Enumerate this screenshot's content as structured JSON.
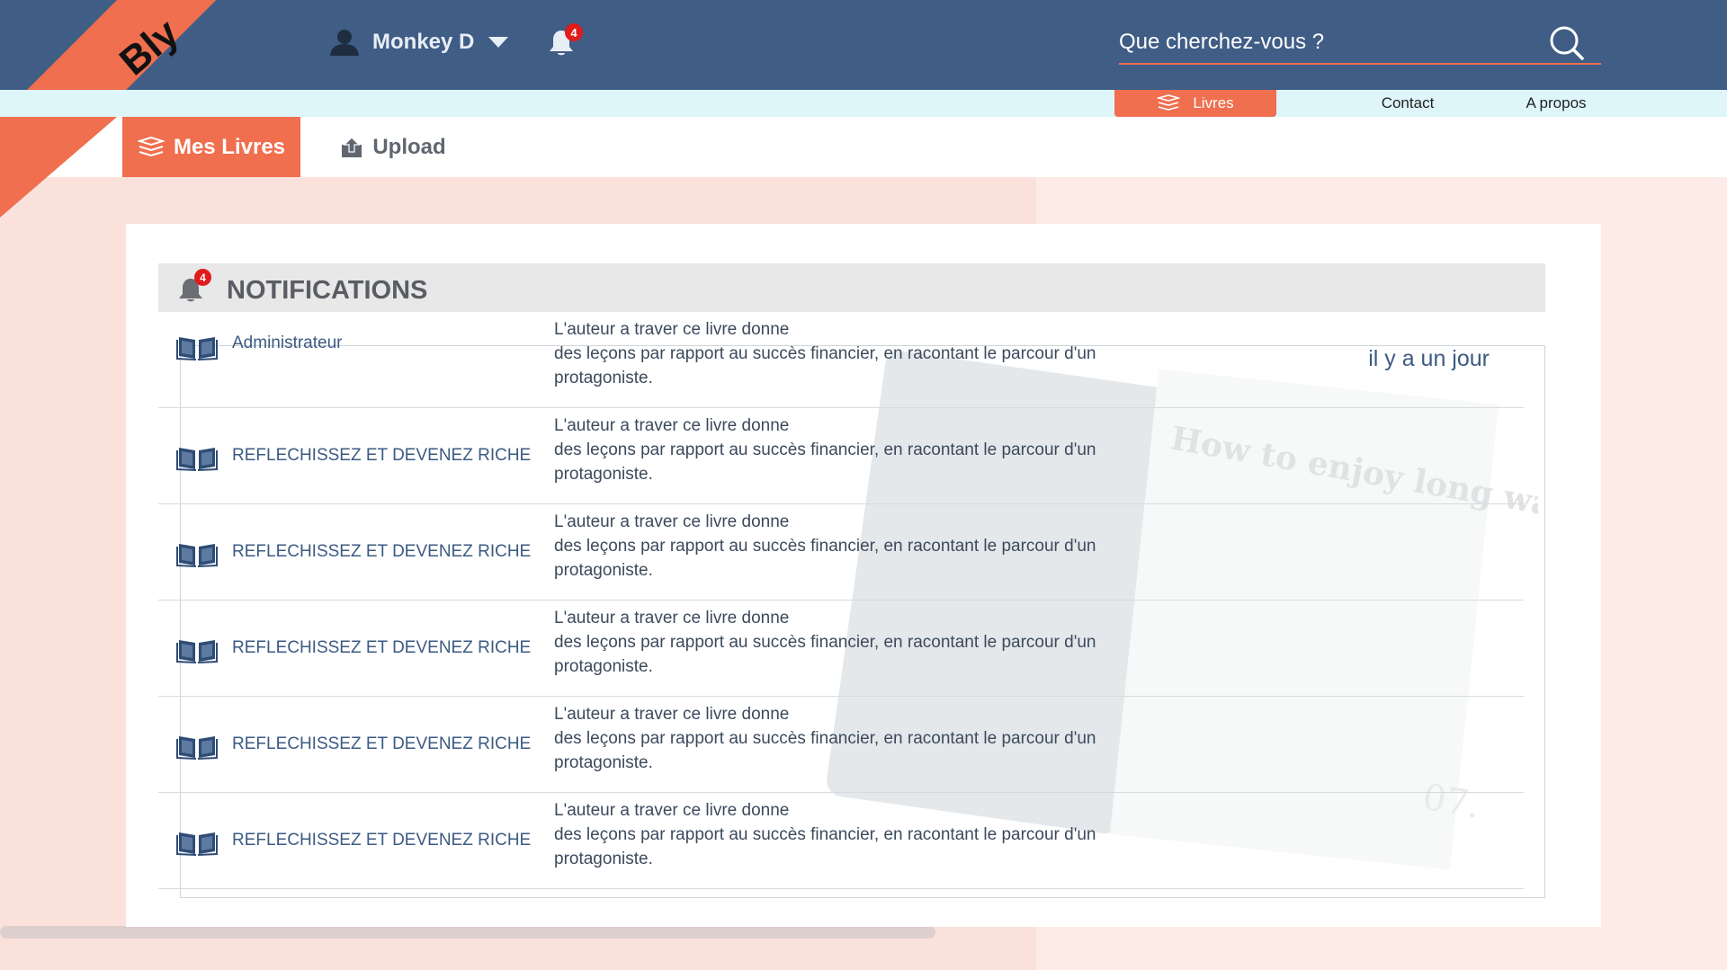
{
  "app": {
    "logo": "Bly",
    "user_name": "Monkey D",
    "notification_count": "4",
    "search_placeholder": "Que cherchez-vous ?"
  },
  "subnav": {
    "items": [
      {
        "label": "Livres",
        "active": true
      },
      {
        "label": "Contact",
        "active": false
      },
      {
        "label": "A propos",
        "active": false
      }
    ]
  },
  "tabs": [
    {
      "label": "Mes Livres",
      "icon": "books-icon",
      "active": true
    },
    {
      "label": "Upload",
      "icon": "upload-icon",
      "active": false
    }
  ],
  "notifications": {
    "title": "NOTIFICATIONS",
    "count": "4",
    "items": [
      {
        "sender": "Administrateur",
        "message": "L'auteur a traver ce livre donne\n des leçons par rapport au succès financier, en racontant le parcour d'un protagoniste.",
        "time": "il y a un jour"
      },
      {
        "sender": "REFLECHISSEZ ET DEVENEZ RICHE",
        "message": "L'auteur a traver ce livre donne\n des leçons par rapport au succès financier, en racontant le parcour d'un protagoniste.",
        "time": ""
      },
      {
        "sender": "REFLECHISSEZ ET DEVENEZ RICHE",
        "message": "L'auteur a traver ce livre donne\n des leçons par rapport au succès financier, en racontant le parcour d'un protagoniste.",
        "time": ""
      },
      {
        "sender": "REFLECHISSEZ ET DEVENEZ RICHE",
        "message": "L'auteur a traver ce livre donne\n des leçons par rapport au succès financier, en racontant le parcour d'un protagoniste.",
        "time": ""
      },
      {
        "sender": "REFLECHISSEZ ET DEVENEZ RICHE",
        "message": "L'auteur a traver ce livre donne\n des leçons par rapport au succès financier, en racontant le parcour d'un protagoniste.",
        "time": ""
      },
      {
        "sender": "REFLECHISSEZ ET DEVENEZ RICHE",
        "message": "L'auteur a traver ce livre donne\n des leçons par rapport au succès financier, en racontant le parcour d'un protagoniste.",
        "time": ""
      }
    ]
  },
  "decor_book_text": {
    "heading": "How to enjoy long walks on the beach.",
    "page_number": "07."
  },
  "colors": {
    "header": "#3f5d85",
    "accent": "#ef6f4f",
    "subnav": "#def6fa",
    "badge": "#e01b1b"
  }
}
